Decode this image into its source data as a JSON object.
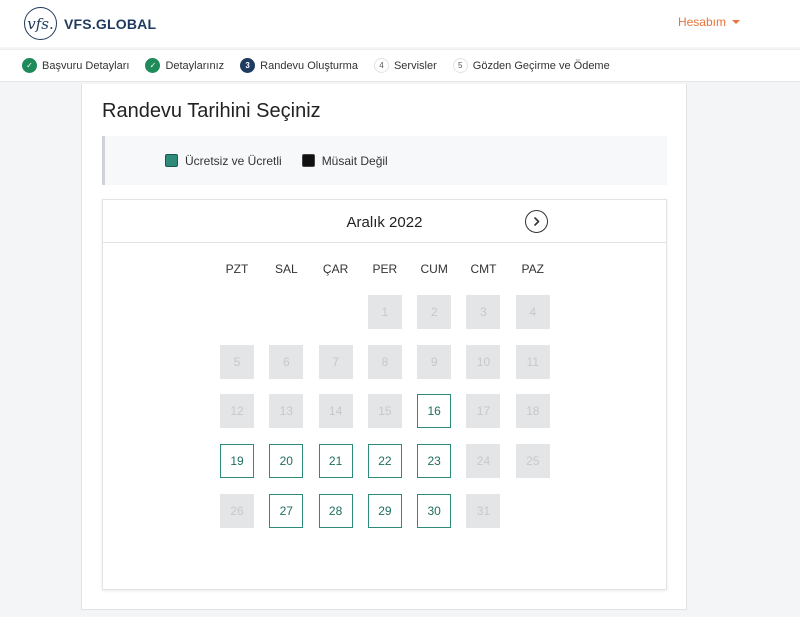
{
  "header": {
    "logo_mark": "vfs.",
    "logo_text": "VFS.GLOBAL",
    "account_label": "Hesabım"
  },
  "steps": [
    {
      "label": "Başvuru Detayları",
      "state": "done",
      "marker": "✓"
    },
    {
      "label": "Detaylarınız",
      "state": "done",
      "marker": "✓"
    },
    {
      "label": "Randevu Oluşturma",
      "state": "current",
      "marker": "3"
    },
    {
      "label": "Servisler",
      "state": "todo",
      "marker": "4"
    },
    {
      "label": "Gözden Geçirme ve Ödeme",
      "state": "todo",
      "marker": "5"
    }
  ],
  "page_title": "Randevu Tarihini Seçiniz",
  "legend": {
    "available_label": "Ücretsiz ve Ücretli",
    "unavailable_label": "Müsait Değil"
  },
  "calendar": {
    "month_label": "Aralık 2022",
    "next_icon": "chevron-right-icon",
    "weekdays": [
      "PZT",
      "SAL",
      "ÇAR",
      "PER",
      "CUM",
      "CMT",
      "PAZ"
    ],
    "leading_empty_days": 3,
    "days": [
      {
        "d": "1",
        "available": false
      },
      {
        "d": "2",
        "available": false
      },
      {
        "d": "3",
        "available": false
      },
      {
        "d": "4",
        "available": false
      },
      {
        "d": "5",
        "available": false
      },
      {
        "d": "6",
        "available": false
      },
      {
        "d": "7",
        "available": false
      },
      {
        "d": "8",
        "available": false
      },
      {
        "d": "9",
        "available": false
      },
      {
        "d": "10",
        "available": false
      },
      {
        "d": "11",
        "available": false
      },
      {
        "d": "12",
        "available": false
      },
      {
        "d": "13",
        "available": false
      },
      {
        "d": "14",
        "available": false
      },
      {
        "d": "15",
        "available": false
      },
      {
        "d": "16",
        "available": true
      },
      {
        "d": "17",
        "available": false
      },
      {
        "d": "18",
        "available": false
      },
      {
        "d": "19",
        "available": true
      },
      {
        "d": "20",
        "available": true
      },
      {
        "d": "21",
        "available": true
      },
      {
        "d": "22",
        "available": true
      },
      {
        "d": "23",
        "available": true
      },
      {
        "d": "24",
        "available": false
      },
      {
        "d": "25",
        "available": false
      },
      {
        "d": "26",
        "available": false
      },
      {
        "d": "27",
        "available": true
      },
      {
        "d": "28",
        "available": true
      },
      {
        "d": "29",
        "available": true
      },
      {
        "d": "30",
        "available": true
      },
      {
        "d": "31",
        "available": false
      }
    ]
  },
  "colors": {
    "accent": "#e8743b",
    "available_border": "#2e8b7a",
    "unavailable_bg": "#e3e5e7",
    "step_done": "#1f8a5a",
    "step_current": "#1f3a5f"
  }
}
